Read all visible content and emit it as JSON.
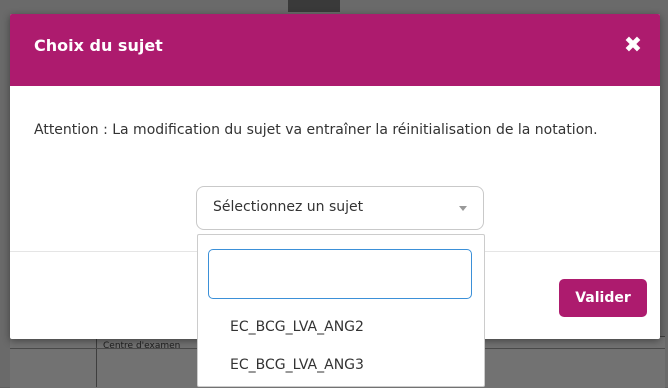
{
  "background": {
    "cell_text": "Centre d'examen"
  },
  "modal": {
    "title": "Choix du sujet",
    "close_icon": "close-icon",
    "warning": "Attention : La modification du sujet va entraîner la réinitialisation de la notation.",
    "select": {
      "placeholder": "Sélectionnez un sujet"
    },
    "validate_label": "Valider"
  },
  "dropdown": {
    "search_value": "",
    "options": [
      "EC_BCG_LVA_ANG2",
      "EC_BCG_LVA_ANG3"
    ]
  },
  "colors": {
    "accent": "#ad1b6e",
    "focus_border": "#3b90d8"
  }
}
